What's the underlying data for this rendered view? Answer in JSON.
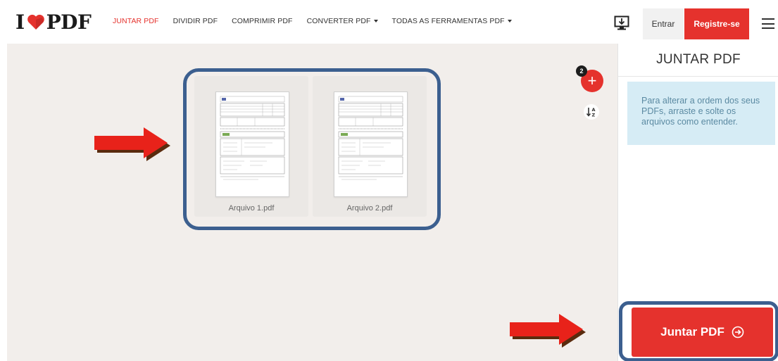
{
  "header": {
    "logo_left": "I",
    "logo_right": "PDF",
    "nav": [
      {
        "label": "JUNTAR PDF",
        "active": true,
        "dropdown": false
      },
      {
        "label": "DIVIDIR PDF",
        "active": false,
        "dropdown": false
      },
      {
        "label": "COMPRIMIR PDF",
        "active": false,
        "dropdown": false
      },
      {
        "label": "CONVERTER PDF",
        "active": false,
        "dropdown": true
      },
      {
        "label": "TODAS AS FERRAMENTAS PDF",
        "active": false,
        "dropdown": true
      }
    ],
    "login_label": "Entrar",
    "signup_label": "Registre-se"
  },
  "files": [
    {
      "name": "Arquivo 1.pdf"
    },
    {
      "name": "Arquivo 2.pdf"
    }
  ],
  "file_count": "2",
  "sidebar": {
    "title": "JUNTAR PDF",
    "info_text": "Para alterar a ordem dos seus PDFs, arraste e solte os arquivos como entender."
  },
  "merge_button_label": "Juntar PDF",
  "colors": {
    "brand_red": "#e5322d",
    "highlight_blue": "#3c5f8f",
    "workspace_bg": "#f2eeeb",
    "info_bg": "#d6ecf5"
  }
}
